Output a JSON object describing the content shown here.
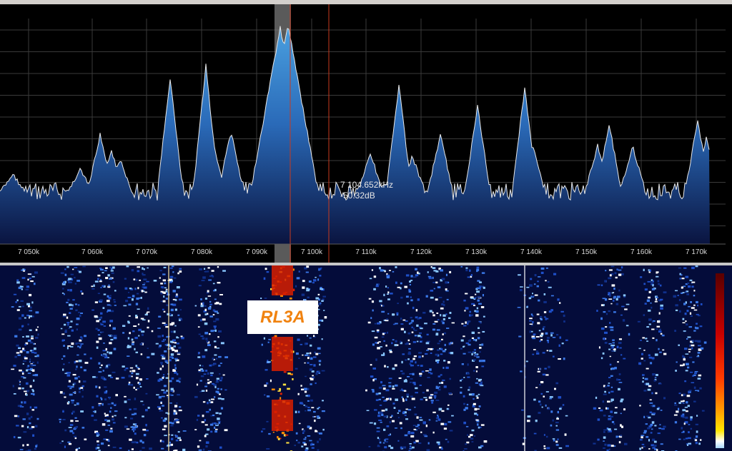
{
  "spectrum": {
    "frequency_axis": [
      "7 050k",
      "7 060k",
      "7 070k",
      "7 080k",
      "7 090k",
      "7 100k",
      "7 110k",
      "7 120k",
      "7 130k",
      "7 140k",
      "7 150k",
      "7 160k",
      "7 170k"
    ],
    "cursor_frequency": "7 104.652kHz",
    "cursor_level": "-50.32dB"
  },
  "waterfall": {
    "callsign_label": "RL3A"
  },
  "colors": {
    "spectrum_fill": "#1e5a9e",
    "trace": "#e8e8e8",
    "cursor_line": "#c83a1e",
    "highlight": "#8a8a8a",
    "callsign": "#f0820f"
  }
}
